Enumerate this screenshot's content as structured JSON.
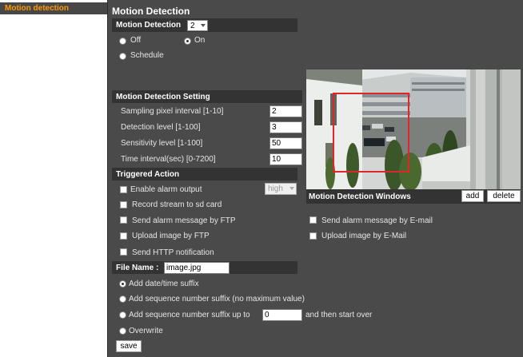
{
  "nav": {
    "active_item": "Motion detection"
  },
  "page": {
    "title": "Motion Detection"
  },
  "motion_detection": {
    "header": "Motion Detection",
    "selected_value": "2",
    "options": {
      "off": "Off",
      "on": "On",
      "schedule": "Schedule"
    },
    "selected_option": "on"
  },
  "settings": {
    "header": "Motion Detection Setting",
    "fields": [
      {
        "label": "Sampling pixel interval [1-10]",
        "value": "2"
      },
      {
        "label": "Detection level [1-100]",
        "value": "3"
      },
      {
        "label": "Sensitivity level [1-100]",
        "value": "50"
      },
      {
        "label": "Time interval(sec) [0-7200]",
        "value": "10"
      }
    ]
  },
  "triggered": {
    "header": "Triggered Action",
    "enable_alarm": "Enable alarm output",
    "alarm_level": "high",
    "record_sd": "Record stream to sd card",
    "ftp_alarm": "Send alarm message by FTP",
    "ftp_upload": "Upload image by FTP",
    "http_notify": "Send HTTP notification",
    "email_alarm": "Send alarm message by E-mail",
    "email_upload": "Upload image by E-Mail"
  },
  "windows": {
    "label": "Motion Detection Windows",
    "add_label": "add",
    "delete_label": "delete"
  },
  "file": {
    "label": "File Name :",
    "value": "image.jpg",
    "options": {
      "datetime": "Add date/time suffix",
      "seq_unlimited": "Add sequence number suffix (no maximum value)",
      "seq_upto": "Add sequence number suffix up to",
      "seq_value": "0",
      "seq_after": "and then start over",
      "overwrite": "Overwrite"
    },
    "selected_option": "datetime"
  },
  "save_label": "save",
  "colors": {
    "nav_active": "#ff9900",
    "panel_bg": "#4a4a4a",
    "header_bg": "#333333",
    "detection_box": "#e0262b"
  }
}
